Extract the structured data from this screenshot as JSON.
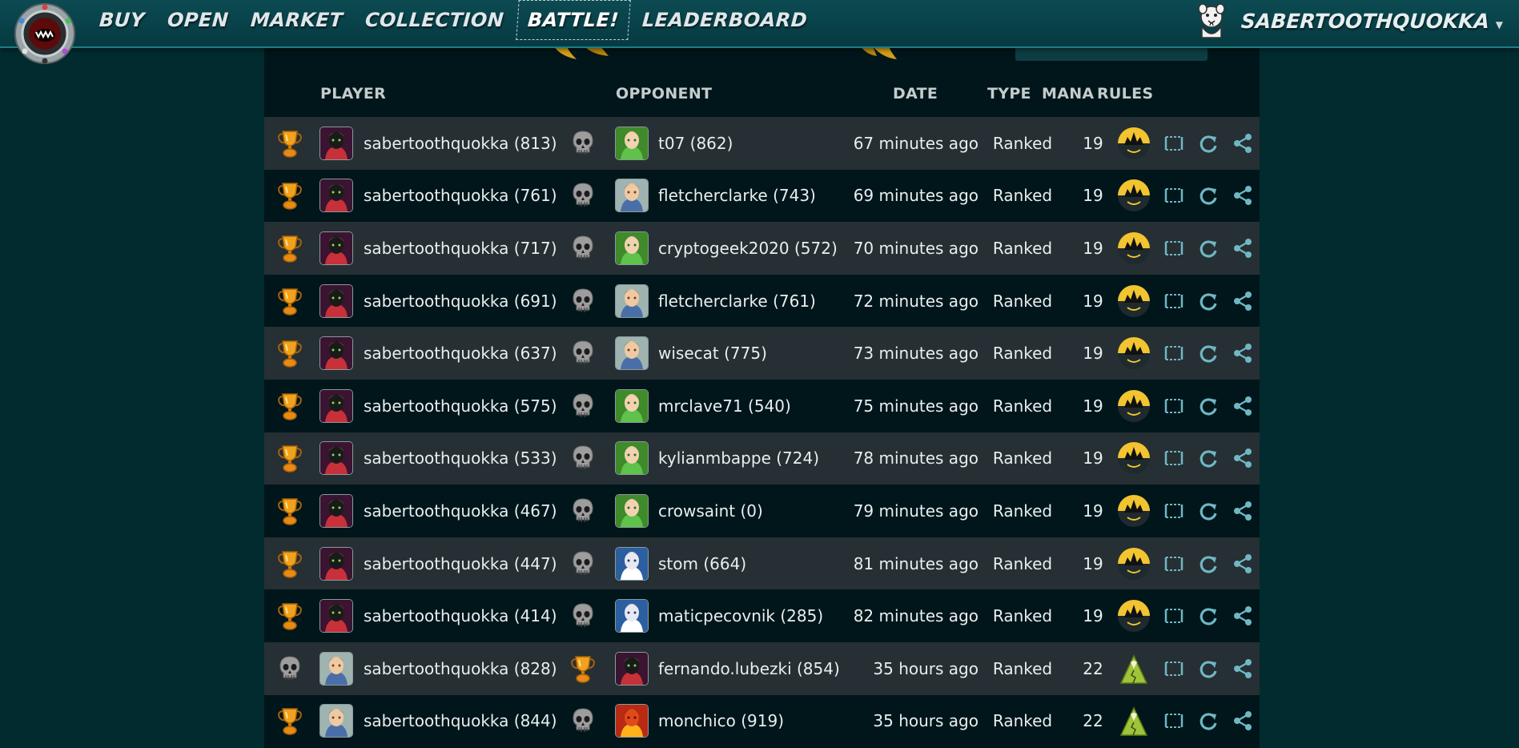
{
  "nav": {
    "items": [
      {
        "label": "BUY",
        "active": false
      },
      {
        "label": "OPEN",
        "active": false
      },
      {
        "label": "MARKET",
        "active": false
      },
      {
        "label": "COLLECTION",
        "active": false
      },
      {
        "label": "BATTLE!",
        "active": true
      },
      {
        "label": "LEADERBOARD",
        "active": false
      }
    ],
    "username": "SABERTOOTHQUOKKA"
  },
  "table": {
    "headers": {
      "player": "PLAYER",
      "opponent": "OPPONENT",
      "date": "DATE",
      "type": "TYPE",
      "mana": "MANA",
      "rules": "RULES"
    },
    "rows": [
      {
        "player_result": "win",
        "player": "sabertoothquokka (813)",
        "player_avatar": "summoner-dark",
        "opponent_result": "loss",
        "opponent": "t07 (862)",
        "opponent_avatar": "summoner-green",
        "date": "67 minutes ago",
        "type": "Ranked",
        "mana": "19",
        "rule": "night-rule"
      },
      {
        "player_result": "win",
        "player": "sabertoothquokka (761)",
        "player_avatar": "summoner-dark",
        "opponent_result": "loss",
        "opponent": "fletcherclarke (743)",
        "opponent_avatar": "summoner-light",
        "date": "69 minutes ago",
        "type": "Ranked",
        "mana": "19",
        "rule": "night-rule"
      },
      {
        "player_result": "win",
        "player": "sabertoothquokka (717)",
        "player_avatar": "summoner-dark",
        "opponent_result": "loss",
        "opponent": "cryptogeek2020 (572)",
        "opponent_avatar": "summoner-green",
        "date": "70 minutes ago",
        "type": "Ranked",
        "mana": "19",
        "rule": "night-rule"
      },
      {
        "player_result": "win",
        "player": "sabertoothquokka (691)",
        "player_avatar": "summoner-dark",
        "opponent_result": "loss",
        "opponent": "fletcherclarke (761)",
        "opponent_avatar": "summoner-light",
        "date": "72 minutes ago",
        "type": "Ranked",
        "mana": "19",
        "rule": "night-rule"
      },
      {
        "player_result": "win",
        "player": "sabertoothquokka (637)",
        "player_avatar": "summoner-dark",
        "opponent_result": "loss",
        "opponent": "wisecat (775)",
        "opponent_avatar": "summoner-light",
        "date": "73 minutes ago",
        "type": "Ranked",
        "mana": "19",
        "rule": "night-rule"
      },
      {
        "player_result": "win",
        "player": "sabertoothquokka (575)",
        "player_avatar": "summoner-dark",
        "opponent_result": "loss",
        "opponent": "mrclave71 (540)",
        "opponent_avatar": "summoner-green",
        "date": "75 minutes ago",
        "type": "Ranked",
        "mana": "19",
        "rule": "night-rule"
      },
      {
        "player_result": "win",
        "player": "sabertoothquokka (533)",
        "player_avatar": "summoner-dark",
        "opponent_result": "loss",
        "opponent": "kylianmbappe (724)",
        "opponent_avatar": "summoner-green",
        "date": "78 minutes ago",
        "type": "Ranked",
        "mana": "19",
        "rule": "night-rule"
      },
      {
        "player_result": "win",
        "player": "sabertoothquokka (467)",
        "player_avatar": "summoner-dark",
        "opponent_result": "loss",
        "opponent": "crowsaint (0)",
        "opponent_avatar": "summoner-green",
        "date": "79 minutes ago",
        "type": "Ranked",
        "mana": "19",
        "rule": "night-rule"
      },
      {
        "player_result": "win",
        "player": "sabertoothquokka (447)",
        "player_avatar": "summoner-dark",
        "opponent_result": "loss",
        "opponent": "stom (664)",
        "opponent_avatar": "summoner-blue",
        "date": "81 minutes ago",
        "type": "Ranked",
        "mana": "19",
        "rule": "night-rule"
      },
      {
        "player_result": "win",
        "player": "sabertoothquokka (414)",
        "player_avatar": "summoner-dark",
        "opponent_result": "loss",
        "opponent": "maticpecovnik (285)",
        "opponent_avatar": "summoner-blue",
        "date": "82 minutes ago",
        "type": "Ranked",
        "mana": "19",
        "rule": "night-rule"
      },
      {
        "player_result": "loss",
        "player": "sabertoothquokka (828)",
        "player_avatar": "summoner-light",
        "opponent_result": "win",
        "opponent": "fernando.lubezki (854)",
        "opponent_avatar": "summoner-dark",
        "date": "35 hours ago",
        "type": "Ranked",
        "mana": "22",
        "rule": "earthquake-rule"
      },
      {
        "player_result": "win",
        "player": "sabertoothquokka (844)",
        "player_avatar": "summoner-light",
        "opponent_result": "loss",
        "opponent": "monchico (919)",
        "opponent_avatar": "summoner-red",
        "date": "35 hours ago",
        "type": "Ranked",
        "mana": "22",
        "rule": "earthquake-rule"
      }
    ]
  },
  "colors": {
    "background": "#022b30",
    "panel": "#00161a",
    "row_alt": "#262f33",
    "action_icon": "#6fb7c4",
    "trophy": "#e69a1e",
    "skull": "#9b9b9b"
  }
}
